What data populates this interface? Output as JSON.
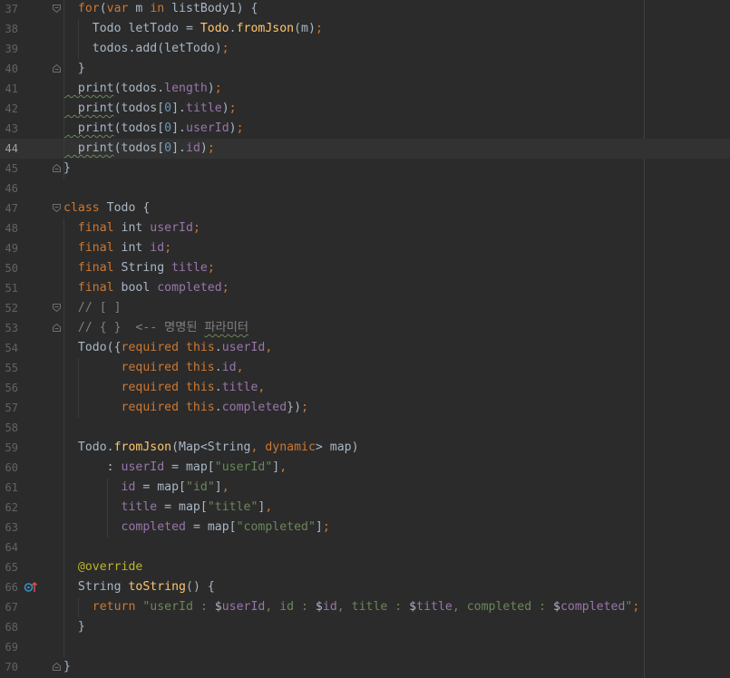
{
  "editor": {
    "current_line": 44,
    "lines": [
      {
        "n": "37",
        "indent": 0,
        "fold": "open",
        "tokens": [
          [
            "k",
            "  for"
          ],
          [
            "t",
            "("
          ],
          [
            "k",
            "var"
          ],
          [
            "t",
            " m "
          ],
          [
            "k",
            "in"
          ],
          [
            "t",
            " listBody1) {"
          ]
        ]
      },
      {
        "n": "38",
        "indent": 1,
        "tokens": [
          [
            "t",
            "    Todo letTodo = "
          ],
          [
            "f",
            "Todo"
          ],
          [
            "t",
            "."
          ],
          [
            "f",
            "fromJson"
          ],
          [
            "t",
            "(m)"
          ],
          [
            "k",
            ";"
          ]
        ]
      },
      {
        "n": "39",
        "indent": 1,
        "tokens": [
          [
            "t",
            "    todos.add(letTodo)"
          ],
          [
            "k",
            ";"
          ]
        ]
      },
      {
        "n": "40",
        "indent": 0,
        "fold": "close",
        "tokens": [
          [
            "t",
            "  }"
          ]
        ]
      },
      {
        "n": "41",
        "indent": 0,
        "tokens": [
          [
            "tu",
            "  print"
          ],
          [
            "t",
            "(todos."
          ],
          [
            "p",
            "length"
          ],
          [
            "t",
            ")"
          ],
          [
            "k",
            ";"
          ]
        ]
      },
      {
        "n": "42",
        "indent": 0,
        "tokens": [
          [
            "tu",
            "  print"
          ],
          [
            "t",
            "(todos["
          ],
          [
            "n",
            "0"
          ],
          [
            "t",
            "]."
          ],
          [
            "p",
            "title"
          ],
          [
            "t",
            ")"
          ],
          [
            "k",
            ";"
          ]
        ]
      },
      {
        "n": "43",
        "indent": 0,
        "tokens": [
          [
            "tu",
            "  print"
          ],
          [
            "t",
            "(todos["
          ],
          [
            "n",
            "0"
          ],
          [
            "t",
            "]."
          ],
          [
            "p",
            "userId"
          ],
          [
            "t",
            ")"
          ],
          [
            "k",
            ";"
          ]
        ]
      },
      {
        "n": "44",
        "indent": 0,
        "tokens": [
          [
            "tu",
            "  print"
          ],
          [
            "t",
            "(todos["
          ],
          [
            "n",
            "0"
          ],
          [
            "t",
            "]."
          ],
          [
            "p",
            "id"
          ],
          [
            "t",
            ")"
          ],
          [
            "k",
            ";"
          ]
        ]
      },
      {
        "n": "45",
        "indent": 0,
        "fold": "close",
        "tokens": [
          [
            "t",
            "}"
          ]
        ]
      },
      {
        "n": "46",
        "indent": 0,
        "tokens": []
      },
      {
        "n": "47",
        "indent": 0,
        "fold": "open",
        "tokens": [
          [
            "k",
            "class "
          ],
          [
            "t",
            "Todo {"
          ]
        ]
      },
      {
        "n": "48",
        "indent": 0,
        "tokens": [
          [
            "k",
            "  final "
          ],
          [
            "t",
            "int "
          ],
          [
            "p",
            "userId"
          ],
          [
            "k",
            ";"
          ]
        ]
      },
      {
        "n": "49",
        "indent": 0,
        "tokens": [
          [
            "k",
            "  final "
          ],
          [
            "t",
            "int "
          ],
          [
            "p",
            "id"
          ],
          [
            "k",
            ";"
          ]
        ]
      },
      {
        "n": "50",
        "indent": 0,
        "tokens": [
          [
            "k",
            "  final "
          ],
          [
            "t",
            "String "
          ],
          [
            "p",
            "title"
          ],
          [
            "k",
            ";"
          ]
        ]
      },
      {
        "n": "51",
        "indent": 0,
        "tokens": [
          [
            "k",
            "  final "
          ],
          [
            "t",
            "bool "
          ],
          [
            "p",
            "completed"
          ],
          [
            "k",
            ";"
          ]
        ]
      },
      {
        "n": "52",
        "indent": 0,
        "fold": "open",
        "tokens": [
          [
            "c",
            "  // [ ]"
          ]
        ]
      },
      {
        "n": "53",
        "indent": 0,
        "fold": "close",
        "tokens": [
          [
            "c",
            "  // { }  <-- 명명된 "
          ],
          [
            "cu",
            "파라미터"
          ]
        ]
      },
      {
        "n": "54",
        "indent": 0,
        "tokens": [
          [
            "t",
            "  Todo({"
          ],
          [
            "k",
            "required "
          ],
          [
            "k",
            "this"
          ],
          [
            "t",
            "."
          ],
          [
            "p",
            "userId"
          ],
          [
            "k",
            ","
          ]
        ]
      },
      {
        "n": "55",
        "indent": 2,
        "tokens": [
          [
            "k",
            "        required "
          ],
          [
            "k",
            "this"
          ],
          [
            "t",
            "."
          ],
          [
            "p",
            "id"
          ],
          [
            "k",
            ","
          ]
        ]
      },
      {
        "n": "56",
        "indent": 2,
        "tokens": [
          [
            "k",
            "        required "
          ],
          [
            "k",
            "this"
          ],
          [
            "t",
            "."
          ],
          [
            "p",
            "title"
          ],
          [
            "k",
            ","
          ]
        ]
      },
      {
        "n": "57",
        "indent": 2,
        "tokens": [
          [
            "k",
            "        required "
          ],
          [
            "k",
            "this"
          ],
          [
            "t",
            "."
          ],
          [
            "p",
            "completed"
          ],
          [
            "t",
            "})"
          ],
          [
            "k",
            ";"
          ]
        ]
      },
      {
        "n": "58",
        "indent": 0,
        "tokens": []
      },
      {
        "n": "59",
        "indent": 0,
        "tokens": [
          [
            "t",
            "  Todo."
          ],
          [
            "f",
            "fromJson"
          ],
          [
            "t",
            "(Map<String"
          ],
          [
            "k",
            ", dynamic"
          ],
          [
            "t",
            "> map)"
          ]
        ]
      },
      {
        "n": "60",
        "indent": 0,
        "tokens": [
          [
            "t",
            "      : "
          ],
          [
            "p",
            "userId"
          ],
          [
            "t",
            " = map["
          ],
          [
            "s",
            "\"userId\""
          ],
          [
            "t",
            "]"
          ],
          [
            "k",
            ","
          ]
        ]
      },
      {
        "n": "61",
        "indent": 3,
        "tokens": [
          [
            "t",
            "        "
          ],
          [
            "p",
            "id"
          ],
          [
            "t",
            " = map["
          ],
          [
            "s",
            "\"id\""
          ],
          [
            "t",
            "]"
          ],
          [
            "k",
            ","
          ]
        ]
      },
      {
        "n": "62",
        "indent": 3,
        "tokens": [
          [
            "t",
            "        "
          ],
          [
            "p",
            "title"
          ],
          [
            "t",
            " = map["
          ],
          [
            "s",
            "\"title\""
          ],
          [
            "t",
            "]"
          ],
          [
            "k",
            ","
          ]
        ]
      },
      {
        "n": "63",
        "indent": 3,
        "tokens": [
          [
            "t",
            "        "
          ],
          [
            "p",
            "completed"
          ],
          [
            "t",
            " = map["
          ],
          [
            "s",
            "\"completed\""
          ],
          [
            "t",
            "]"
          ],
          [
            "k",
            ";"
          ]
        ]
      },
      {
        "n": "64",
        "indent": 0,
        "tokens": []
      },
      {
        "n": "65",
        "indent": 0,
        "tokens": [
          [
            "a",
            "  @override"
          ]
        ]
      },
      {
        "n": "66",
        "indent": 0,
        "gutter_icon": "override-method-icon",
        "tokens": [
          [
            "t",
            "  String "
          ],
          [
            "f",
            "toString"
          ],
          [
            "t",
            "() {"
          ]
        ]
      },
      {
        "n": "67",
        "indent": 1,
        "tokens": [
          [
            "k",
            "    return "
          ],
          [
            "s",
            "\"userId : "
          ],
          [
            "t",
            "$"
          ],
          [
            "p",
            "userId"
          ],
          [
            "s",
            ", id : "
          ],
          [
            "t",
            "$"
          ],
          [
            "p",
            "id"
          ],
          [
            "s",
            ", title : "
          ],
          [
            "t",
            "$"
          ],
          [
            "p",
            "title"
          ],
          [
            "s",
            ", completed : "
          ],
          [
            "t",
            "$"
          ],
          [
            "p",
            "completed"
          ],
          [
            "s",
            "\""
          ],
          [
            "k",
            ";"
          ]
        ]
      },
      {
        "n": "68",
        "indent": 0,
        "tokens": [
          [
            "t",
            "  }"
          ]
        ]
      },
      {
        "n": "69",
        "indent": 0,
        "tokens": []
      },
      {
        "n": "70",
        "indent": 0,
        "fold": "close",
        "tokens": [
          [
            "t",
            "}"
          ]
        ]
      }
    ]
  },
  "colors": {
    "background": "#2b2b2b",
    "current_line": "#323232",
    "keyword": "#cc7832",
    "function": "#ffc66d",
    "property": "#9876aa",
    "string": "#6a8759",
    "number": "#6897bb",
    "comment": "#808080",
    "annotation": "#bbb529",
    "text": "#a9b7c6",
    "line_number": "#606366"
  }
}
